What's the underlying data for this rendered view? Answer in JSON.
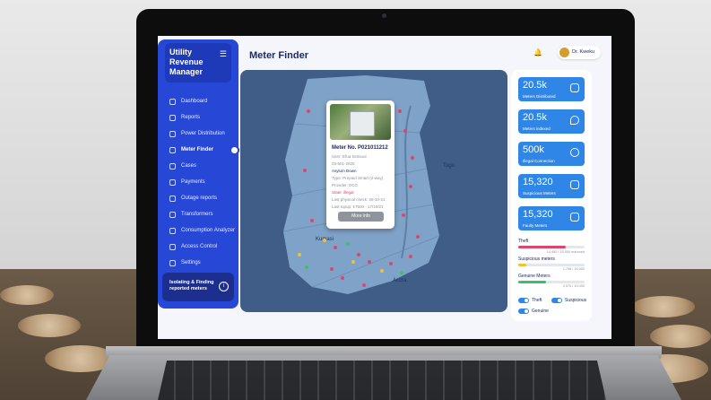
{
  "app": {
    "title": "Utility Revenue Manager",
    "page_title": "Meter Finder"
  },
  "user": {
    "name": "Dr. Kweku"
  },
  "sidebar": {
    "items": [
      {
        "label": "Dashboard"
      },
      {
        "label": "Reports"
      },
      {
        "label": "Power Distribution"
      },
      {
        "label": "Meter Finder",
        "active": true
      },
      {
        "label": "Cases"
      },
      {
        "label": "Payments"
      },
      {
        "label": "Outage reports"
      },
      {
        "label": "Transformers"
      },
      {
        "label": "Consumption Analyzer"
      },
      {
        "label": "Access Control"
      },
      {
        "label": "Settings"
      }
    ],
    "card": {
      "label": "Isolating & Finding reported meters"
    }
  },
  "map": {
    "labels": {
      "togo": "Togo",
      "kumasi": "Kumasi",
      "accra": "Accra"
    },
    "popup": {
      "title": "Meter No. P021011212",
      "user": "User: Efua Sintsuor",
      "phone": "03-501-2025",
      "location": "Asylum Down",
      "type": "Type: Prepaid Smart (2-way)",
      "provider": "Provider: ECG",
      "state": "State: illegal",
      "last_check": "Last physical check: 26-10-21",
      "last_topup": "Last topup: ¢7500 - 17/10/21",
      "button": "More info"
    }
  },
  "stats": [
    {
      "value": "20.5k",
      "label": "Meters Distributed",
      "icon": "meter-icon"
    },
    {
      "value": "20.5k",
      "label": "Meters indexed",
      "icon": "location-pin-icon"
    },
    {
      "value": "500k",
      "label": "Illegal Connection",
      "icon": "link-icon"
    },
    {
      "value": "15,320",
      "label": "Suspicious Meters",
      "icon": "flag-icon"
    },
    {
      "value": "15,320",
      "label": "Faulty Meters",
      "icon": "tools-icon"
    }
  ],
  "bars": [
    {
      "label": "Theft",
      "count": "14,490 / 15,000 enforced",
      "fraction": 0.72,
      "color": "#e0446b"
    },
    {
      "label": "Suspicious meters",
      "count": "1,758 / 15,000",
      "fraction": 0.12,
      "color": "#f2c12e"
    },
    {
      "label": "Genuine Meters",
      "count": "2,570 / 15,000",
      "fraction": 0.42,
      "color": "#3cbf6a"
    }
  ],
  "toggles": {
    "theft": "Theft",
    "suspicious": "Suspicious",
    "genuine": "Genuine"
  },
  "colors": {
    "sidebar": "#2747d6",
    "stat_card": "#2f86e6",
    "map": "#3f5d86",
    "country": "#7fa3c8"
  }
}
